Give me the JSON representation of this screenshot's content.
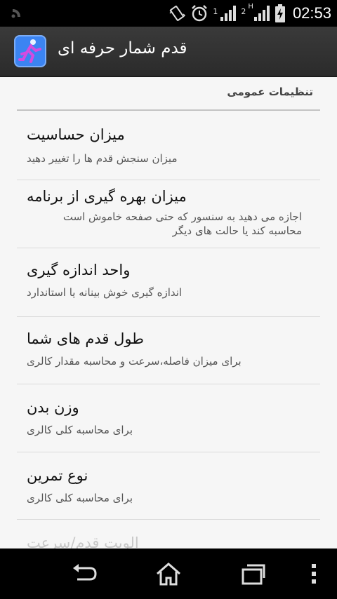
{
  "status_bar": {
    "sim1_label": "1",
    "sim2_label": "2",
    "sim2_network": "H",
    "time": "02:53"
  },
  "action_bar": {
    "title": "قدم شمار حرفه ای",
    "icon": "runner-app-icon"
  },
  "settings": {
    "category": "تنظیمات عمومی",
    "items": [
      {
        "title": "میزان حساسیت",
        "summary": "میزان سنجش قدم ها را تغییر دهید"
      },
      {
        "title": "میزان بهره گیری از برنامه",
        "summary": "اجازه می دهید به سنسور که حتی صفحه خاموش است محاسبه کند یا حالت های دیگر"
      },
      {
        "title": "واحد اندازه گیری",
        "summary": "اندازه گیری خوش بینانه یا استاندارد"
      },
      {
        "title": "طول قدم های شما",
        "summary": "برای میزان فاصله،سرعت و محاسبه مقدار کالری"
      },
      {
        "title": "وزن بدن",
        "summary": "برای محاسبه کلی کالری"
      },
      {
        "title": "نوع تمرین",
        "summary": "برای محاسبه کلی کالری"
      },
      {
        "title": "الویت قدم/سرعت",
        "summary": ""
      }
    ]
  },
  "nav_bar": {
    "buttons": [
      "back-icon",
      "home-icon",
      "recent-apps-icon",
      "menu-icon"
    ]
  },
  "colors": {
    "status_bar_bg": "#000000",
    "action_bar_bg": "#2f2f2f",
    "content_bg": "#f6f6f6",
    "app_icon_bg": "#3b84f2"
  }
}
